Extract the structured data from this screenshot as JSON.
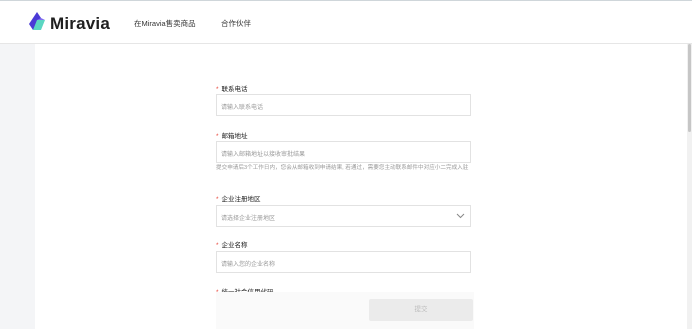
{
  "header": {
    "brand": "Miravia",
    "nav": [
      "在Miravia售卖商品",
      "合作伙伴"
    ]
  },
  "form": {
    "fields": [
      {
        "label": "联系电话",
        "placeholder": "请输入联系电话",
        "required": true
      },
      {
        "label": "邮箱地址",
        "placeholder": "请输入邮箱地址以接收审批结果",
        "required": true
      },
      {
        "label": "企业注册地区",
        "placeholder": "请选择企业注册地区",
        "required": true,
        "type": "select"
      },
      {
        "label": "企业名称",
        "placeholder": "请输入您的企业名称",
        "required": true
      },
      {
        "label": "统一社会信用代码",
        "required": true
      }
    ],
    "email_hint": "提交申请后3个工作日内，您会从邮箱收到申请结果, 若通过，需要您主动联系邮件中对应小二完成入驻",
    "submit_label": "提交",
    "required_mark": "*"
  },
  "colors": {
    "required": "#e8473c",
    "brand_dark": "#3b3bd6",
    "brand_teal": "#55d2c6"
  }
}
